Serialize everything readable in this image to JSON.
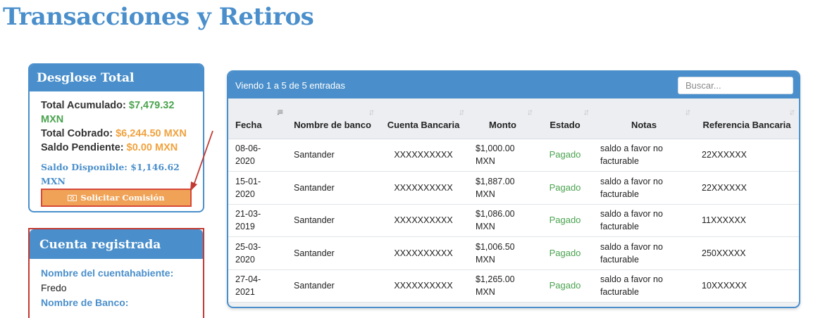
{
  "page": {
    "title": "Transacciones y Retiros"
  },
  "summary": {
    "header": "Desglose Total",
    "total_acumulado_label": "Total Acumulado:",
    "total_acumulado_value": "$7,479.32 MXN",
    "total_cobrado_label": "Total Cobrado:",
    "total_cobrado_value": "$6,244.50 MXN",
    "saldo_pendiente_label": "Saldo Pendiente:",
    "saldo_pendiente_value": "$0.00 MXN",
    "saldo_disponible": "Saldo Disponible: $1,146.62 MXN",
    "button_label": "Solicitar Comisión"
  },
  "account": {
    "header": "Cuenta registrada",
    "holder_label": "Nombre del cuentahabiente:",
    "holder_value": "Fredo",
    "bank_label": "Nombre de Banco:"
  },
  "table": {
    "info": "Viendo 1 a 5 de 5 entradas",
    "search_placeholder": "Buscar...",
    "columns": {
      "fecha": "Fecha",
      "banco": "Nombre de banco",
      "cuenta": "Cuenta Bancaria",
      "monto": "Monto",
      "estado": "Estado",
      "notas": "Notas",
      "referencia": "Referencia Bancaria"
    },
    "rows": [
      {
        "fecha": "08-06-2020",
        "banco": "Santander",
        "cuenta": "XXXXXXXXXX",
        "monto": "$1,000.00 MXN",
        "estado": "Pagado",
        "notas": "saldo a favor no facturable",
        "referencia": "22XXXXXX"
      },
      {
        "fecha": "15-01-2020",
        "banco": "Santander",
        "cuenta": "XXXXXXXXXX",
        "monto": "$1,887.00 MXN",
        "estado": "Pagado",
        "notas": "saldo a favor no facturable",
        "referencia": "22XXXXXX"
      },
      {
        "fecha": "21-03-2019",
        "banco": "Santander",
        "cuenta": "XXXXXXXXXX",
        "monto": "$1,086.00 MXN",
        "estado": "Pagado",
        "notas": "saldo a favor no facturable",
        "referencia": "11XXXXXX"
      },
      {
        "fecha": "25-03-2020",
        "banco": "Santander",
        "cuenta": "XXXXXXXXXX",
        "monto": "$1,006.50 MXN",
        "estado": "Pagado",
        "notas": "saldo a favor no facturable",
        "referencia": "250XXXXX"
      },
      {
        "fecha": "27-04-2021",
        "banco": "Santander",
        "cuenta": "XXXXXXXXXX",
        "monto": "$1,265.00 MXN",
        "estado": "Pagado",
        "notas": "saldo a favor no facturable",
        "referencia": "10XXXXXX"
      }
    ]
  },
  "colors": {
    "primary": "#4a8fcb",
    "success": "#4aa34f",
    "warning": "#f0a23e",
    "annotation": "#c23a32"
  }
}
